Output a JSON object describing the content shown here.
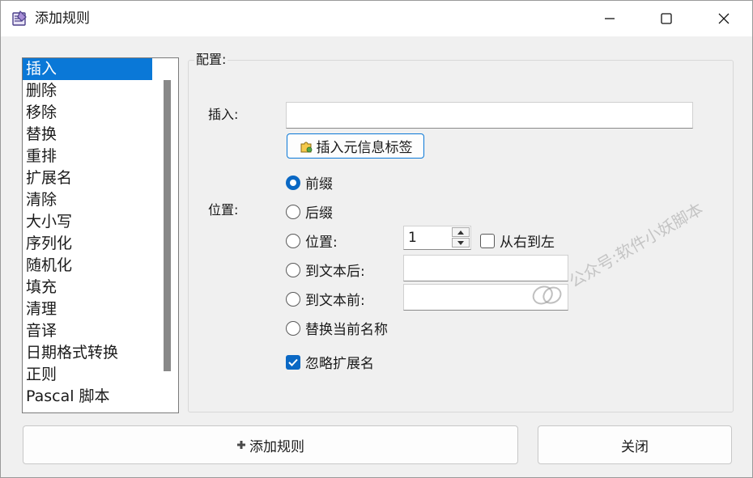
{
  "window": {
    "title": "添加规则",
    "controls": [
      "minimize",
      "maximize",
      "close"
    ]
  },
  "rules_list": {
    "items": [
      "插入",
      "删除",
      "移除",
      "替换",
      "重排",
      "扩展名",
      "清除",
      "大小写",
      "序列化",
      "随机化",
      "填充",
      "清理",
      "音译",
      "日期格式转换",
      "正则",
      "Pascal 脚本"
    ],
    "selected_index": 0
  },
  "config": {
    "group_label": "配置:",
    "insert_label": "插入:",
    "insert_value": "",
    "meta_button_label": "插入元信息标签",
    "position_label": "位置:",
    "options": {
      "prefix": "前缀",
      "suffix": "后缀",
      "position": "位置:",
      "after_text": "到文本后:",
      "before_text": "到文本前:",
      "replace_name": "替换当前名称"
    },
    "selected_option": "prefix",
    "position_value": "1",
    "right_to_left_label": "从右到左",
    "right_to_left_checked": false,
    "after_text_value": "",
    "before_text_value": "",
    "ignore_ext_label": "忽略扩展名",
    "ignore_ext_checked": true
  },
  "footer": {
    "add_button": "添加规则",
    "close_button": "关闭"
  },
  "watermark": "公众号:软件小妖脚本",
  "colors": {
    "accent": "#0a78d7",
    "selected_bg": "#0a78d7",
    "window_bg": "#f0f0f0"
  }
}
